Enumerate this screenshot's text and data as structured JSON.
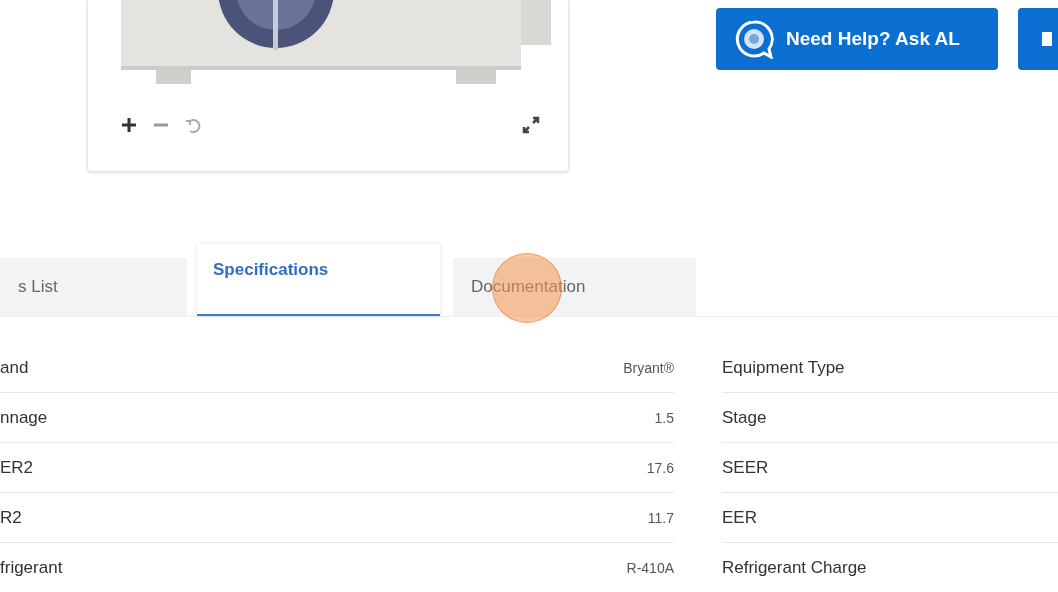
{
  "viewer": {
    "controls": [
      {
        "kind": "zoom-in"
      },
      {
        "kind": "zoom-out"
      },
      {
        "kind": "reset"
      }
    ],
    "fullscreen": {
      "kind": "expand"
    }
  },
  "actions": [
    {
      "kind": "help",
      "label": "Need Help? Ask AL"
    },
    {
      "kind": "partial"
    }
  ],
  "tabs": [
    {
      "label": "s List",
      "selected": false
    },
    {
      "label": "Specifications",
      "selected": true
    },
    {
      "label": "Documentation",
      "selected": false
    }
  ],
  "specs_left": [
    {
      "label": "and",
      "value": "Bryant®"
    },
    {
      "label": "nnage",
      "value": "1.5"
    },
    {
      "label": "ER2",
      "value": "17.6"
    },
    {
      "label": "R2",
      "value": "11.7"
    },
    {
      "label": "frigerant",
      "value": "R-410A"
    }
  ],
  "specs_right": [
    {
      "label": "Equipment Type"
    },
    {
      "label": "Stage"
    },
    {
      "label": "SEER"
    },
    {
      "label": "EER"
    },
    {
      "label": "Refrigerant Charge"
    }
  ]
}
